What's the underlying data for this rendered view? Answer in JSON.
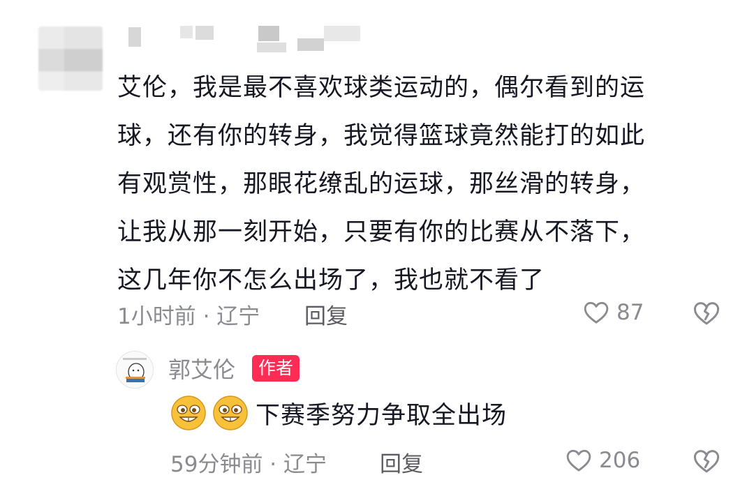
{
  "comment": {
    "text": "艾伦，我是最不喜欢球类运动的，偶尔看到的运\n球，还有你的转身，我觉得篮球竟然能打的如此\n有观赏性，那眼花缭乱的运球，那丝滑的转身，\n让我从那一刻开始，只要有你的比赛从不落下，\n这几年你不怎么出场了，我也就不看了",
    "time_location": "1小时前 · 辽宁",
    "reply_label": "回复",
    "like_count": "87",
    "icons": {
      "like": "heart-outline-icon",
      "dislike": "broken-heart-icon"
    }
  },
  "author_reply": {
    "name": "郭艾伦",
    "badge": "作者",
    "emojis": [
      "grin-emoji",
      "grin-emoji"
    ],
    "text": "下赛季努力争取全出场",
    "time_location": "59分钟前 · 辽宁",
    "reply_label": "回复",
    "like_count": "206",
    "icons": {
      "like": "heart-outline-icon",
      "dislike": "broken-heart-icon"
    }
  },
  "colors": {
    "text": "#161823",
    "meta": "#8a8b91",
    "badge": "#fe2c55"
  }
}
